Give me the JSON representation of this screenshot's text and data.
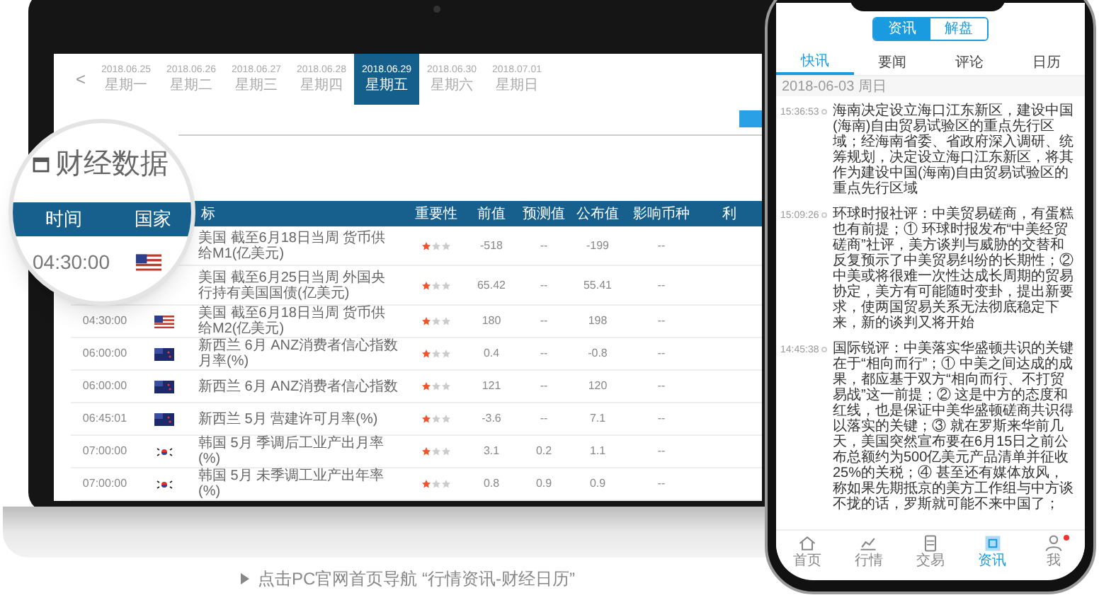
{
  "laptop": {
    "back_arrow": "<",
    "date_tabs": [
      {
        "date": "2018.06.25",
        "weekday": "星期一",
        "selected": false
      },
      {
        "date": "2018.06.26",
        "weekday": "星期二",
        "selected": false
      },
      {
        "date": "2018.06.27",
        "weekday": "星期三",
        "selected": false
      },
      {
        "date": "2018.06.28",
        "weekday": "星期四",
        "selected": false
      },
      {
        "date": "2018.06.29",
        "weekday": "星期五",
        "selected": true
      },
      {
        "date": "2018.06.30",
        "weekday": "星期六",
        "selected": false
      },
      {
        "date": "2018.07.01",
        "weekday": "星期日",
        "selected": false
      }
    ],
    "magnifier": {
      "title": "财经数据",
      "columns": [
        "时间",
        "国家"
      ],
      "time": "04:30:00",
      "kind": "us"
    },
    "table": {
      "columns": [
        "标",
        "重要性",
        "前值",
        "预测值",
        "公布值",
        "影响币种",
        "利"
      ],
      "rows": [
        {
          "indicator": "美国 截至6月18日当周 货币供给M1(亿美元)",
          "stars": 1,
          "previous": "-518",
          "forecast": "--",
          "actual": "-199",
          "currency": "--"
        },
        {
          "indicator": "美国 截至6月25日当周 外国央行持有美国国债(亿美元)",
          "stars": 1,
          "previous": "65.42",
          "forecast": "--",
          "actual": "55.41",
          "currency": "--"
        },
        {
          "time": "04:30:00",
          "kind": "us",
          "indicator": "美国 截至6月18日当周 货币供给M2(亿美元)",
          "stars": 1,
          "previous": "180",
          "forecast": "--",
          "actual": "198",
          "currency": "--"
        },
        {
          "time": "06:00:00",
          "kind": "nz",
          "indicator": "新西兰 6月 ANZ消费者信心指数月率(%)",
          "stars": 1,
          "previous": "0.4",
          "forecast": "--",
          "actual": "-0.8",
          "currency": "--"
        },
        {
          "time": "06:00:00",
          "kind": "nz",
          "indicator": "新西兰 6月 ANZ消费者信心指数",
          "stars": 1,
          "previous": "121",
          "forecast": "--",
          "actual": "120",
          "currency": "--"
        },
        {
          "time": "06:45:01",
          "kind": "nz",
          "indicator": "新西兰 5月 营建许可月率(%)",
          "stars": 1,
          "previous": "-3.6",
          "forecast": "--",
          "actual": "7.1",
          "currency": "--"
        },
        {
          "time": "07:00:00",
          "kind": "kr",
          "indicator": "韩国 5月 季调后工业产出月率(%)",
          "stars": 1,
          "previous": "3.1",
          "forecast": "0.2",
          "actual": "1.1",
          "currency": "--"
        },
        {
          "time": "07:00:00",
          "kind": "kr",
          "indicator": "韩国 5月 未季调工业产出年率(%)",
          "stars": 1,
          "previous": "0.8",
          "forecast": "0.9",
          "actual": "0.9",
          "currency": "--"
        }
      ]
    }
  },
  "phone": {
    "segments": [
      {
        "label": "资讯",
        "selected": true
      },
      {
        "label": "解盘",
        "selected": false
      }
    ],
    "tabs": [
      {
        "label": "快讯",
        "selected": true
      },
      {
        "label": "要闻",
        "selected": false
      },
      {
        "label": "评论",
        "selected": false
      },
      {
        "label": "日历",
        "selected": false
      }
    ],
    "date": "2018-06-03 周日",
    "news": [
      {
        "time": "15:36:53",
        "text": "海南决定设立海口江东新区，建设中国(海南)自由贸易试验区的重点先行区域；经海南省委、省政府深入调研、统筹规划，决定设立海口江东新区，将其作为建设中国(海南)自由贸易试验区的重点先行区域"
      },
      {
        "time": "15:09:26",
        "text": "环球时报社评：中美贸易磋商，有蛋糕也有前提；① 环球时报发布“中美经贸磋商”社评，美方谈判与威胁的交替和反复预示了中美贸易纠纷的长期性；② 中美或将很难一次性达成长周期的贸易协定，美方有可能随时变卦，提出新要求，使两国贸易关系无法彻底稳定下来，新的谈判又将开始"
      },
      {
        "time": "14:45:38",
        "text": "国际锐评：中美落实华盛顿共识的关键在于“相向而行”；① 中美之间达成的成果，都应基于双方“相向而行、不打贸易战”这一前提；② 这是中方的态度和红线，也是保证中美华盛顿磋商共识得以落实的关键；③ 就在罗斯来华前几天，美国突然宣布要在6月15日之前公布总额约为500亿美元产品清单并征收25%的关税；④ 甚至还有媒体放风，称如果先期抵京的美方工作组与中方谈不拢的话，罗斯就可能不来中国了；"
      }
    ],
    "nav": [
      {
        "kind": "home",
        "label": "首页",
        "selected": false,
        "badge": false
      },
      {
        "kind": "chart",
        "label": "行情",
        "selected": false,
        "badge": false
      },
      {
        "kind": "trade",
        "label": "交易",
        "selected": false,
        "badge": false
      },
      {
        "kind": "news",
        "label": "资讯",
        "selected": true,
        "badge": false
      },
      {
        "kind": "user",
        "label": "我",
        "selected": false,
        "badge": true
      }
    ]
  },
  "caption": "点击PC官网首页导航 “行情资讯-财经日历”"
}
